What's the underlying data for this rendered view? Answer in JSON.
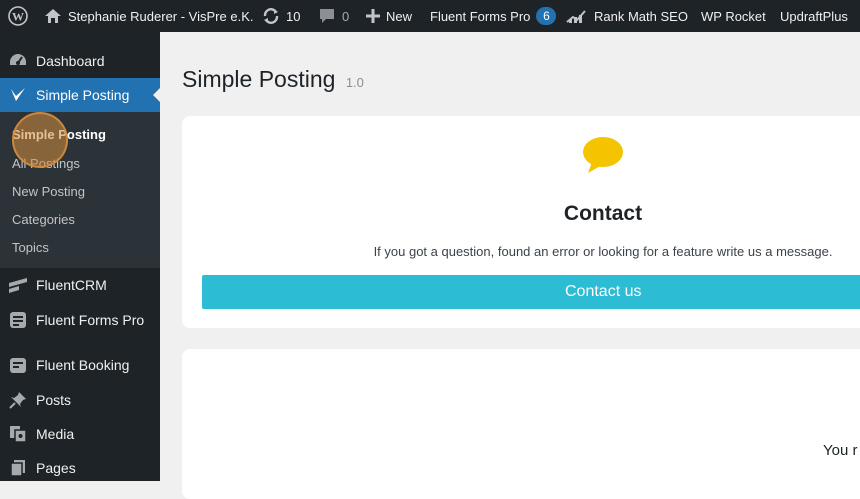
{
  "admin_bar": {
    "site_name": "Stephanie Ruderer - VisPre e.K.",
    "updates_count": "10",
    "comments_count": "0",
    "new_label": "New",
    "fluent_forms_label": "Fluent Forms Pro",
    "fluent_forms_badge": "6",
    "rank_math_label": "Rank Math SEO",
    "wp_rocket_label": "WP Rocket",
    "updraft_label": "UpdraftPlus"
  },
  "sidebar": {
    "dashboard": "Dashboard",
    "simple_posting": "Simple Posting",
    "submenu": [
      "Simple Posting",
      "All Postings",
      "New Posting",
      "Categories",
      "Topics"
    ],
    "fluentcrm": "FluentCRM",
    "fluent_forms_pro": "Fluent Forms Pro",
    "fluent_booking": "Fluent Booking",
    "posts": "Posts",
    "media": "Media",
    "pages": "Pages"
  },
  "main": {
    "title": "Simple Posting",
    "version": "1.0",
    "contact": {
      "heading": "Contact",
      "description": "If you got a question, found an error or looking for a feature write us a message.",
      "button_label": "Contact us"
    },
    "second_card_text": "You r"
  },
  "colors": {
    "admin_bg": "#1d2327",
    "active_blue": "#2271b1",
    "button_cyan": "#2cbcd4",
    "bubble_yellow": "#f5c400"
  }
}
